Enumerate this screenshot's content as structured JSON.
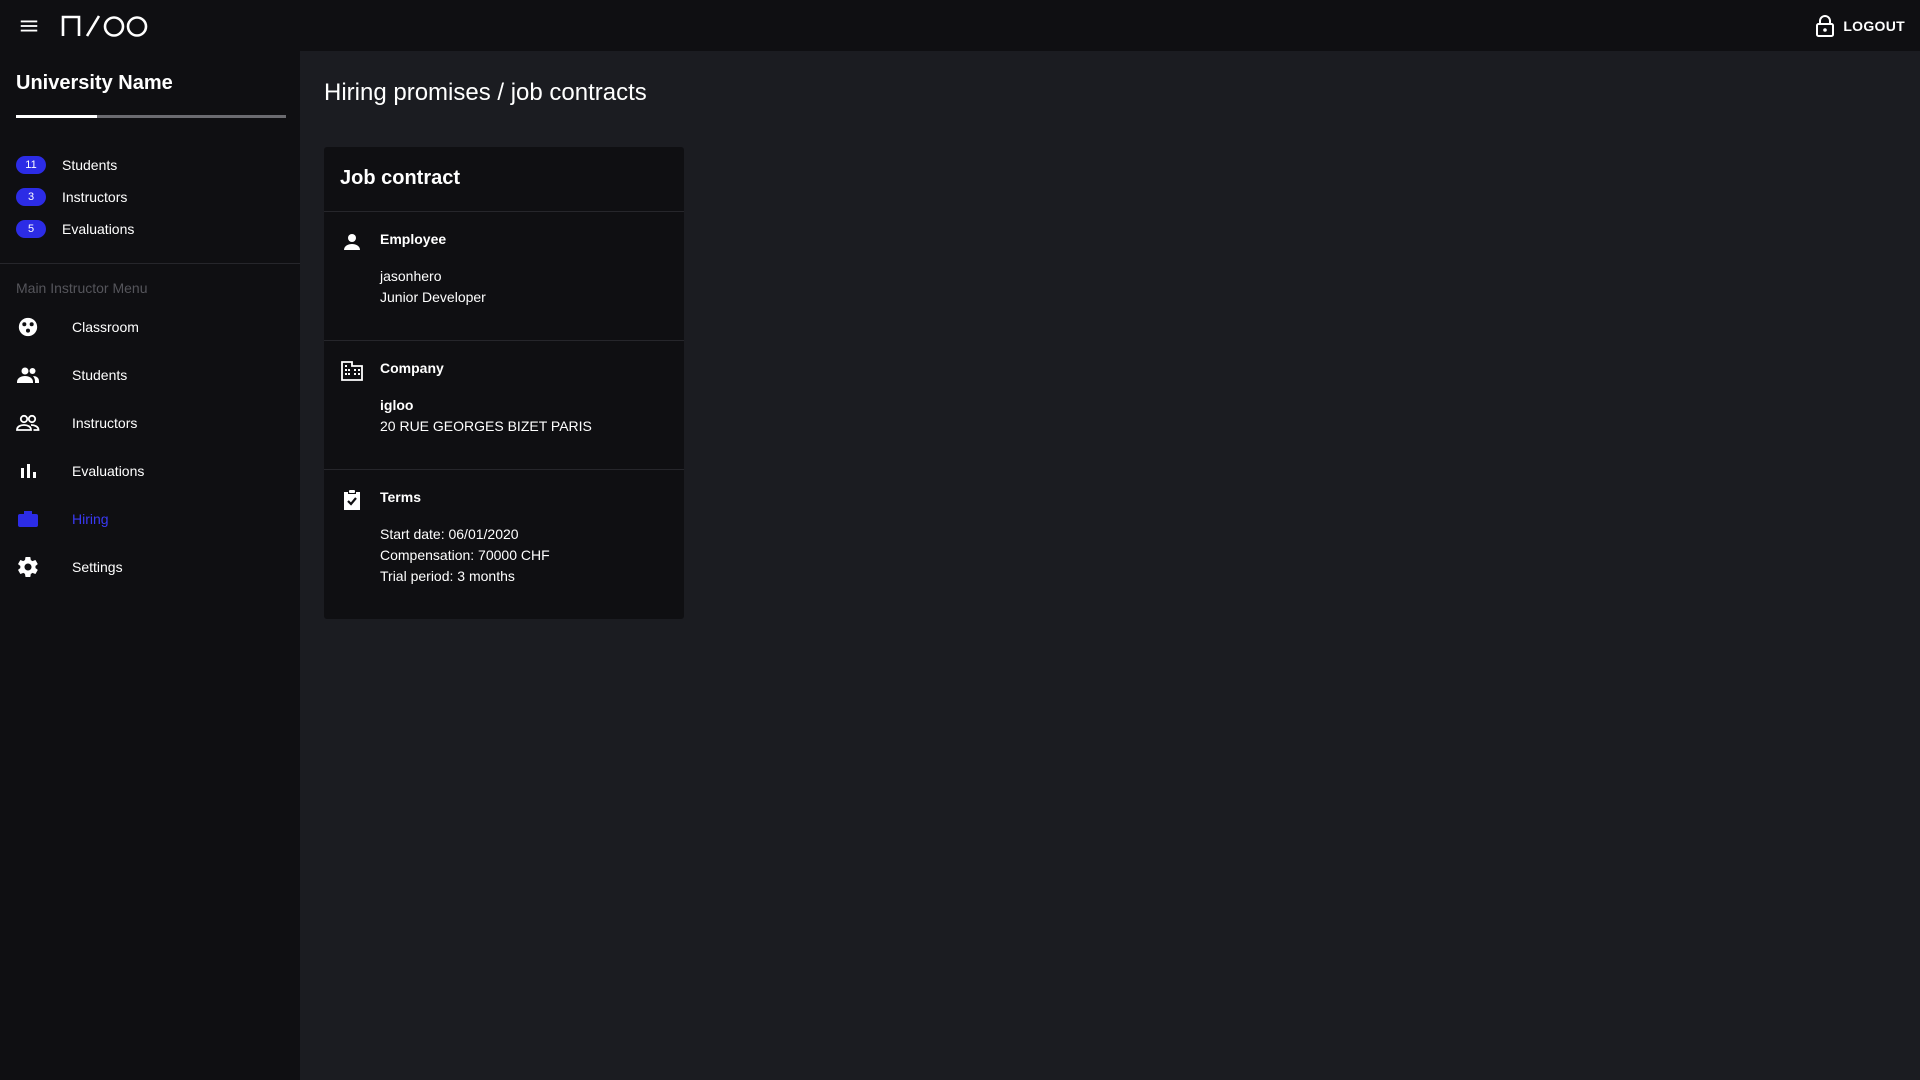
{
  "app": {
    "logo_alt": "N/OO"
  },
  "topbar": {
    "logout_label": "LOGOUT"
  },
  "sidebar": {
    "title": "University Name",
    "progress": 0.3,
    "counts": [
      {
        "value": "11",
        "label": "Students"
      },
      {
        "value": "3",
        "label": "Instructors"
      },
      {
        "value": "5",
        "label": "Evaluations"
      }
    ],
    "menu_heading": "Main Instructor Menu",
    "items": [
      {
        "label": "Classroom",
        "icon": "classroom-icon"
      },
      {
        "label": "Students",
        "icon": "students-icon"
      },
      {
        "label": "Instructors",
        "icon": "instructors-icon"
      },
      {
        "label": "Evaluations",
        "icon": "bar-chart-icon"
      },
      {
        "label": "Hiring",
        "icon": "briefcase-icon",
        "active": true
      },
      {
        "label": "Settings",
        "icon": "gear-icon"
      }
    ]
  },
  "main": {
    "title": "Hiring promises / job contracts",
    "card": {
      "title": "Job contract",
      "employee": {
        "title": "Employee",
        "username": "jasonhero",
        "role": "Junior Developer"
      },
      "company": {
        "title": "Company",
        "name": "igloo",
        "address": "20 RUE GEORGES BIZET PARIS"
      },
      "terms": {
        "title": "Terms",
        "start_date": "Start date: 06/01/2020",
        "compensation": "Compensation: 70000 CHF",
        "trial_period": "Trial period: 3 months"
      }
    }
  },
  "colors": {
    "accent": "#2c2ce6",
    "active_text": "#3a3af5",
    "background": "#1b1c21",
    "panel": "#0f0f12"
  }
}
